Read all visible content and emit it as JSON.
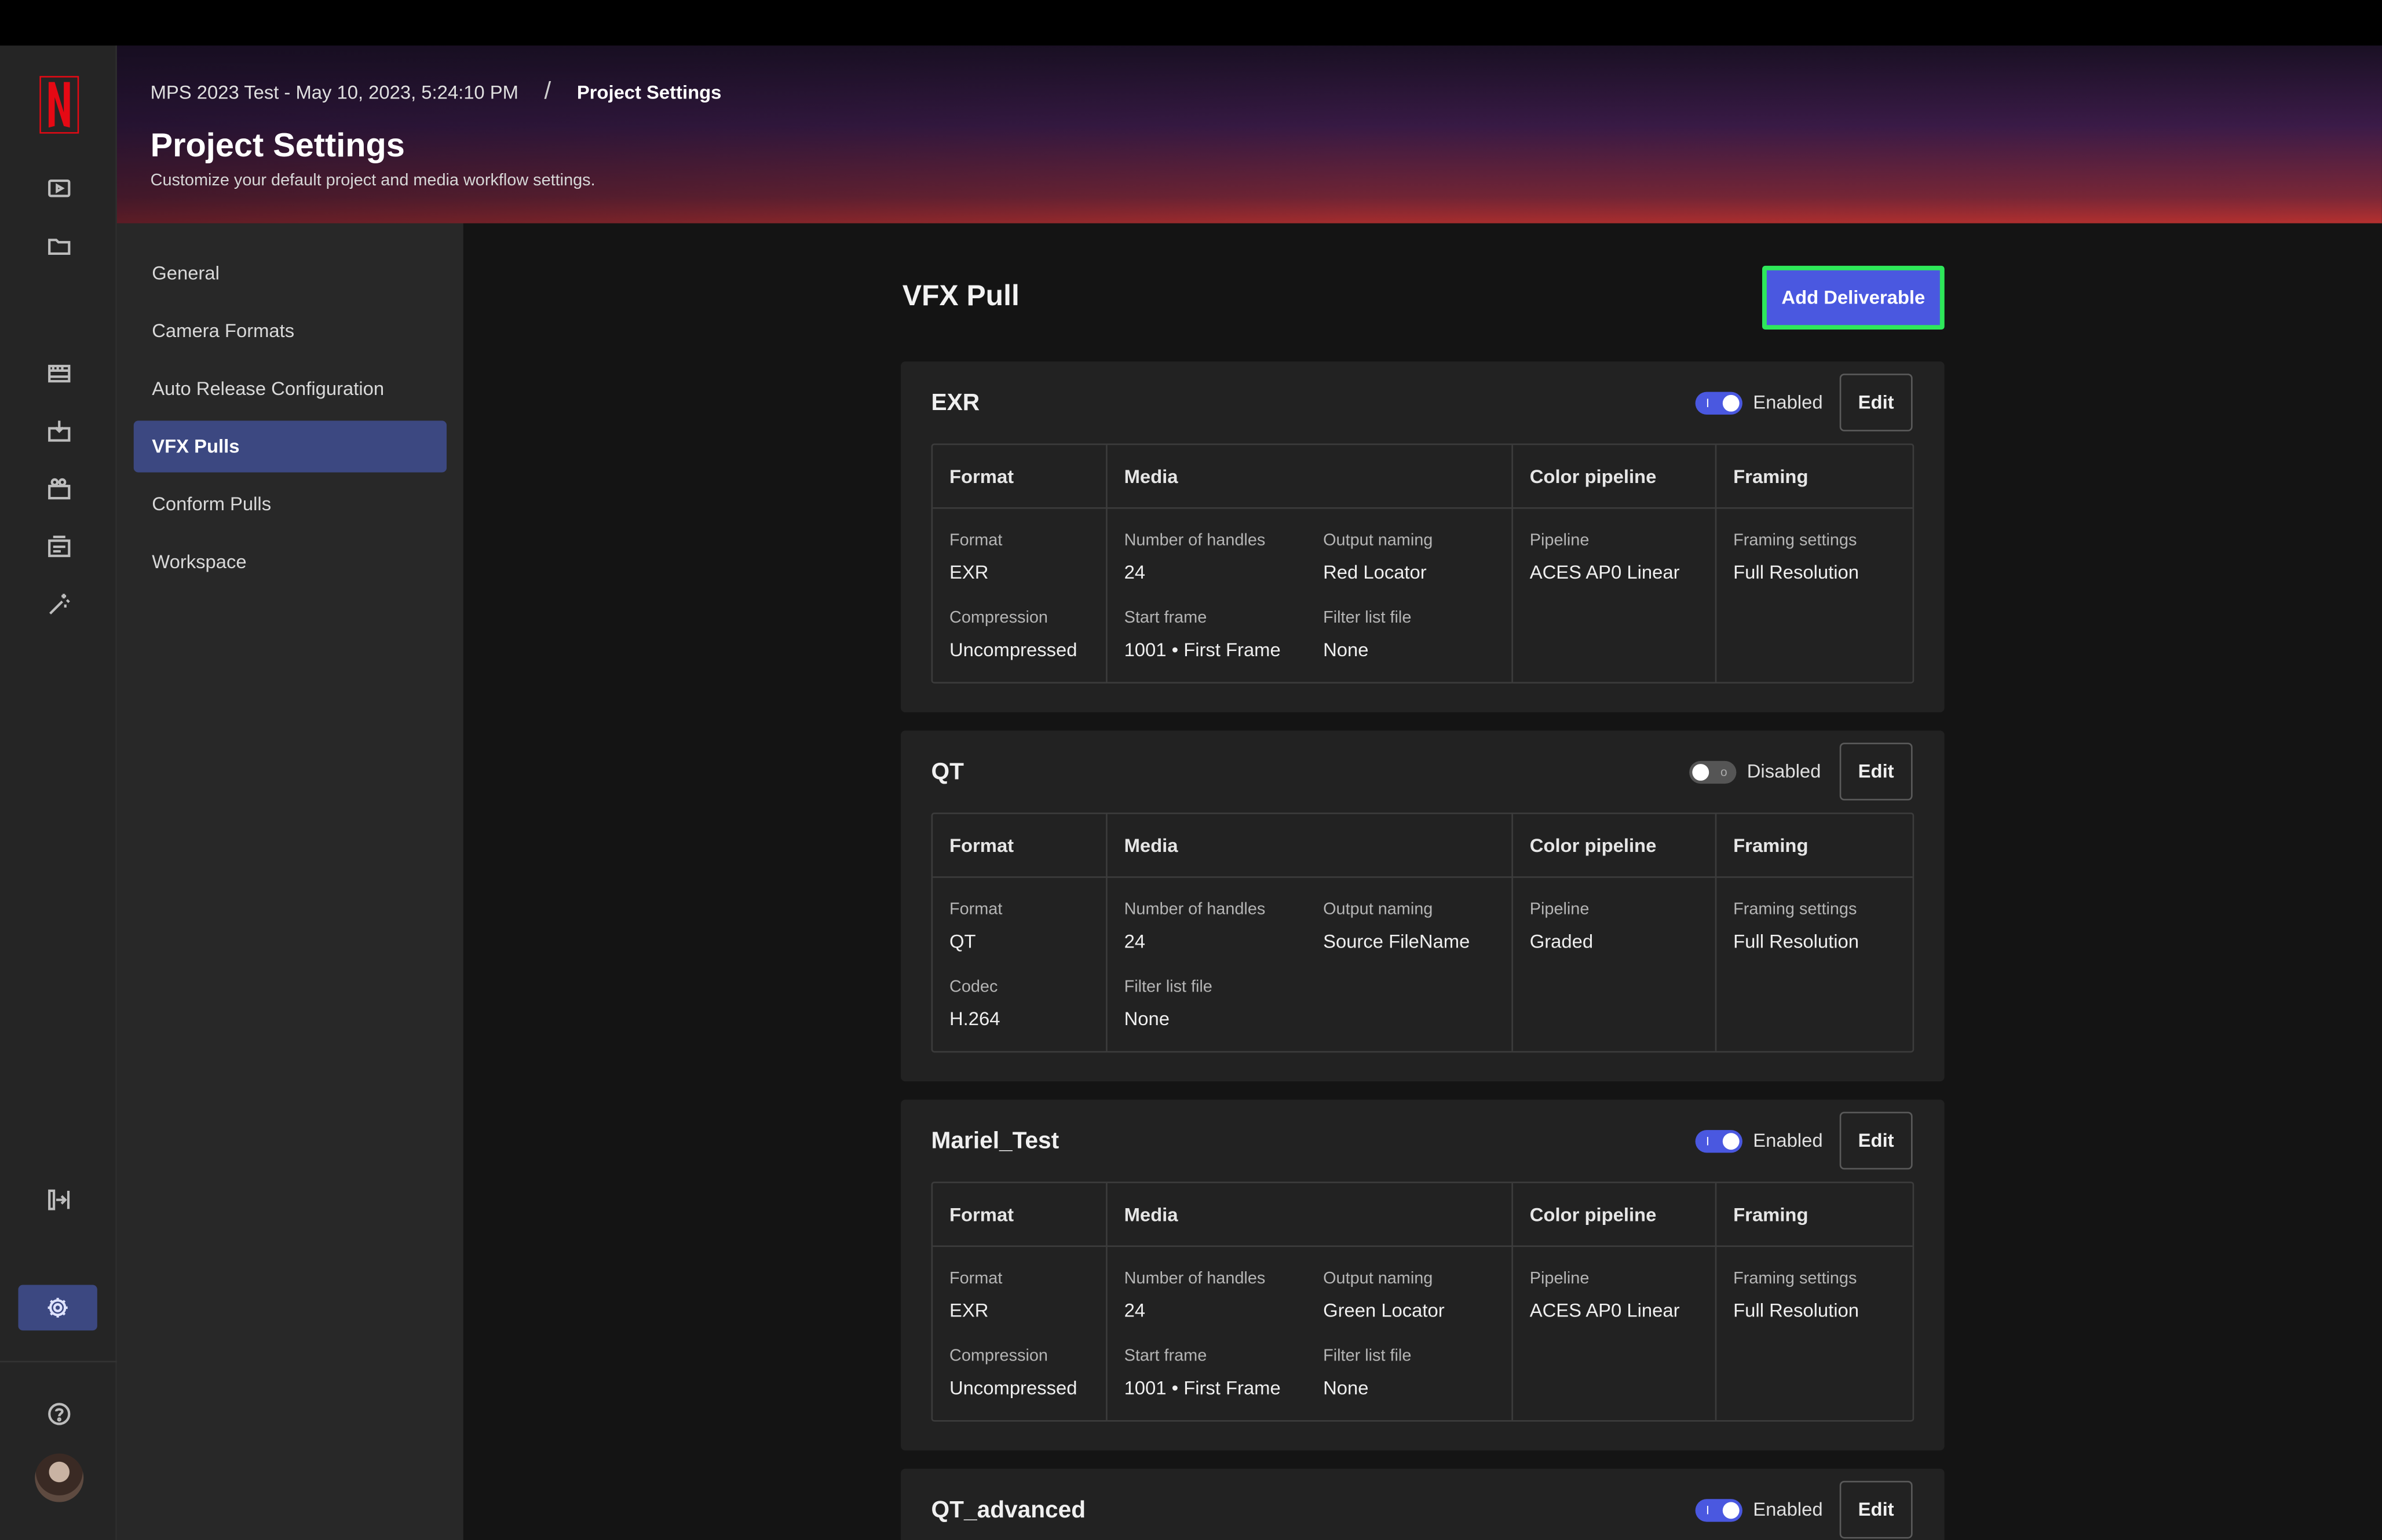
{
  "breadcrumb": {
    "project": "MPS 2023 Test - May 10, 2023, 5:24:10 PM",
    "separator": "/",
    "current": "Project Settings"
  },
  "page": {
    "title": "Project Settings",
    "subtitle": "Customize your default project and media workflow settings."
  },
  "subnav": [
    "General",
    "Camera Formats",
    "Auto Release Configuration",
    "VFX Pulls",
    "Conform Pulls",
    "Workspace"
  ],
  "subnav_active": "VFX Pulls",
  "section": {
    "title": "VFX Pull",
    "add_button": "Add Deliverable"
  },
  "headers": {
    "format": "Format",
    "media": "Media",
    "color": "Color pipeline",
    "framing": "Framing"
  },
  "cards": [
    {
      "title": "EXR",
      "status": "Enabled",
      "edit": "Edit",
      "format": [
        {
          "label": "Format",
          "value": "EXR"
        },
        {
          "label": "Compression",
          "value": "Uncompressed"
        }
      ],
      "media_left": [
        {
          "label": "Number of handles",
          "value": "24"
        },
        {
          "label": "Start frame",
          "value": "1001 • First Frame"
        }
      ],
      "media_right": [
        {
          "label": "Output naming",
          "value": "Red Locator"
        },
        {
          "label": "Filter list file",
          "value": "None"
        }
      ],
      "color": {
        "label": "Pipeline",
        "value": "ACES AP0 Linear"
      },
      "framing": {
        "label": "Framing settings",
        "value": "Full Resolution"
      }
    },
    {
      "title": "QT",
      "status": "Disabled",
      "edit": "Edit",
      "format": [
        {
          "label": "Format",
          "value": "QT"
        },
        {
          "label": "Codec",
          "value": "H.264"
        }
      ],
      "media_left": [
        {
          "label": "Number of handles",
          "value": "24"
        },
        {
          "label": "Filter list file",
          "value": "None"
        }
      ],
      "media_right": [
        {
          "label": "Output naming",
          "value": "Source FileName"
        }
      ],
      "color": {
        "label": "Pipeline",
        "value": "Graded"
      },
      "framing": {
        "label": "Framing settings",
        "value": "Full Resolution"
      }
    },
    {
      "title": "Mariel_Test",
      "status": "Enabled",
      "edit": "Edit",
      "format": [
        {
          "label": "Format",
          "value": "EXR"
        },
        {
          "label": "Compression",
          "value": "Uncompressed"
        }
      ],
      "media_left": [
        {
          "label": "Number of handles",
          "value": "24"
        },
        {
          "label": "Start frame",
          "value": "1001 • First Frame"
        }
      ],
      "media_right": [
        {
          "label": "Output naming",
          "value": "Green Locator"
        },
        {
          "label": "Filter list file",
          "value": "None"
        }
      ],
      "color": {
        "label": "Pipeline",
        "value": "ACES AP0 Linear"
      },
      "framing": {
        "label": "Framing settings",
        "value": "Full Resolution"
      }
    },
    {
      "title": "QT_advanced",
      "status": "Enabled",
      "edit": "Edit"
    }
  ],
  "colors": {
    "accent": "#4a58e0",
    "active_nav": "#3c4881",
    "highlight_border": "#2ee85a",
    "logo_red": "#e50914"
  }
}
